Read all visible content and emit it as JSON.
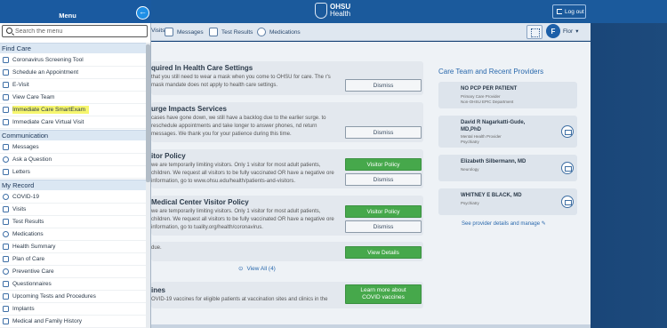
{
  "topbar": {
    "logo_line1": "OHSU",
    "logo_line2": "Health",
    "logout_label": "Log out"
  },
  "menubar": {
    "items": [
      "Visits",
      "Messages",
      "Test Results",
      "Medications"
    ],
    "user_initial": "F",
    "user_name": "Flor"
  },
  "cards": [
    {
      "title": "quired In Health Care Settings",
      "text": "that you still need to wear a mask when you come to OHSU for care. The r's mask mandate does not apply to health care settings.",
      "buttons": [
        "Dismiss"
      ]
    },
    {
      "title": "urge Impacts Services",
      "text": "cases have gone down, we still have a backlog due to the earlier surge. to reschedule appointments and take longer to answer phones, nd return messages. We thank you for your patience during this time.",
      "buttons": [
        "Dismiss"
      ]
    },
    {
      "title": "itor Policy",
      "text": "we are temporarily limiting visitors. Only 1 visitor for most adult patients, children. We request all visitors to be fully vaccinated OR have a negative ore information, go to www.ohsu.edu/health/patients-and-visitors.",
      "buttons": [
        "Visitor Policy",
        "Dismiss"
      ]
    },
    {
      "title": "Medical Center Visitor Policy",
      "text": "we are temporarily limiting visitors. Only 1 visitor for most adult patients, children. We request all visitors to be fully vaccinated OR have a negative ore information, go to tuality.org/health/coronavirus.",
      "buttons": [
        "Visitor Policy",
        "Dismiss"
      ]
    },
    {
      "title": "",
      "text": "due.",
      "buttons": [
        "View Details"
      ]
    },
    {
      "title": "ines",
      "text": "OVID-19 vaccines for eligible patients at vaccination sites and clinics in the",
      "buttons": [
        "Learn more about COVID vaccines"
      ]
    }
  ],
  "view_all": "View All (4)",
  "care_team": {
    "title": "Care Team and Recent Providers",
    "providers": [
      {
        "name": "NO PCP PER PATIENT",
        "sub1": "Primary Care Provider",
        "sub2": "Non-OHSU EPIC Department"
      },
      {
        "name": "David R Nagarkatti-Gude, MD,PhD",
        "sub1": "Mental Health Provider",
        "sub2": "Psychiatry"
      },
      {
        "name": "Elizabeth Silbermann, MD",
        "sub1": "Neurology",
        "sub2": ""
      },
      {
        "name": "WHITNEY E BLACK, MD",
        "sub1": "Psychiatry",
        "sub2": ""
      }
    ],
    "see_more": "See provider details and manage"
  },
  "menu": {
    "title": "Menu",
    "search_placeholder": "Search the menu",
    "sections": [
      {
        "label": "Find Care",
        "items": [
          "Coronavirus Screening Tool",
          "Schedule an Appointment",
          "E-Visit",
          "View Care Team",
          "Immediate Care SmartExam",
          "Immediate Care Virtual Visit"
        ]
      },
      {
        "label": "Communication",
        "items": [
          "Messages",
          "Ask a Question",
          "Letters"
        ]
      },
      {
        "label": "My Record",
        "items": [
          "COVID-19",
          "Visits",
          "Test Results",
          "Medications",
          "Health Summary",
          "Plan of Care",
          "Preventive Care",
          "Questionnaires",
          "Upcoming Tests and Procedures",
          "Implants",
          "Medical and Family History"
        ]
      }
    ],
    "highlighted_item": "Immediate Care SmartExam",
    "highlight_color": "#f6f66e"
  },
  "colors": {
    "brand_blue": "#1a5aa0",
    "accent_green": "#46a84b",
    "link_blue": "#2a69ad"
  }
}
